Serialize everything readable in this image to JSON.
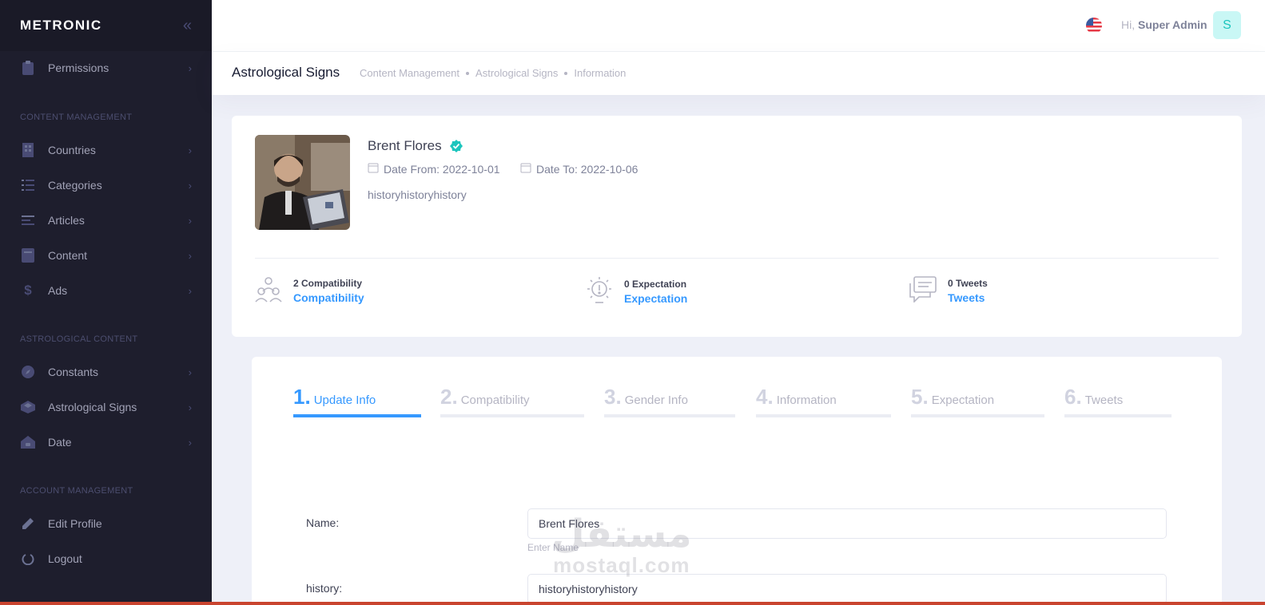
{
  "brand": {
    "name": "METRONIC",
    "collapse_icon": "double-chevron-left-icon"
  },
  "sidebar": {
    "items": [
      {
        "label": "Permissions",
        "icon": "clipboard-icon"
      },
      {
        "label": "Countries",
        "icon": "building-icon"
      },
      {
        "label": "Categories",
        "icon": "list-icon"
      },
      {
        "label": "Articles",
        "icon": "text-lines-icon"
      },
      {
        "label": "Content",
        "icon": "document-icon"
      },
      {
        "label": "Ads",
        "icon": "dollar-icon"
      },
      {
        "label": "Constants",
        "icon": "compass-icon"
      },
      {
        "label": "Astrological Signs",
        "icon": "box-icon"
      },
      {
        "label": "Date",
        "icon": "home-icon"
      },
      {
        "label": "Edit Profile",
        "icon": "pencil-icon"
      },
      {
        "label": "Logout",
        "icon": "power-icon"
      }
    ],
    "sections": [
      "CONTENT MANAGEMENT",
      "ASTROLOGICAL CONTENT",
      "ACCOUNT MANAGEMENT"
    ]
  },
  "header": {
    "greeting": "Hi,",
    "user": "Super Admin",
    "avatar_letter": "S",
    "flag_icon": "us-flag-icon"
  },
  "subheader": {
    "title": "Astrological Signs",
    "breadcrumbs": [
      "Content Management",
      "Astrological Signs",
      "Information"
    ]
  },
  "profile": {
    "name": "Brent Flores",
    "date_from": "Date From: 2022-10-01",
    "date_to": "Date To: 2022-10-06",
    "description": "historyhistoryhistory",
    "stats": [
      {
        "count": "2 Compatibility",
        "link": "Compatibility",
        "icon": "users-icon"
      },
      {
        "count": "0 Expectation",
        "link": "Expectation",
        "icon": "lightbulb-icon"
      },
      {
        "count": "0 Tweets",
        "link": "Tweets",
        "icon": "chat-icon"
      }
    ]
  },
  "wizard": {
    "steps": [
      {
        "num": "1.",
        "label": "Update Info"
      },
      {
        "num": "2.",
        "label": "Compatibility"
      },
      {
        "num": "3.",
        "label": "Gender Info"
      },
      {
        "num": "4.",
        "label": "Information"
      },
      {
        "num": "5.",
        "label": "Expectation"
      },
      {
        "num": "6.",
        "label": "Tweets"
      }
    ],
    "active_step": 1
  },
  "form": {
    "name_label": "Name:",
    "name_value": "Brent Flores",
    "name_help": "Enter Name",
    "history_label": "history:",
    "history_value": "historyhistoryhistory"
  },
  "watermark": {
    "line1": "مستقل",
    "line2": "mostaql.com"
  },
  "colors": {
    "sidebar_bg": "#1e1e2d",
    "primary": "#3699ff",
    "success": "#1bc5bd",
    "page_bg": "#eef0f8"
  }
}
